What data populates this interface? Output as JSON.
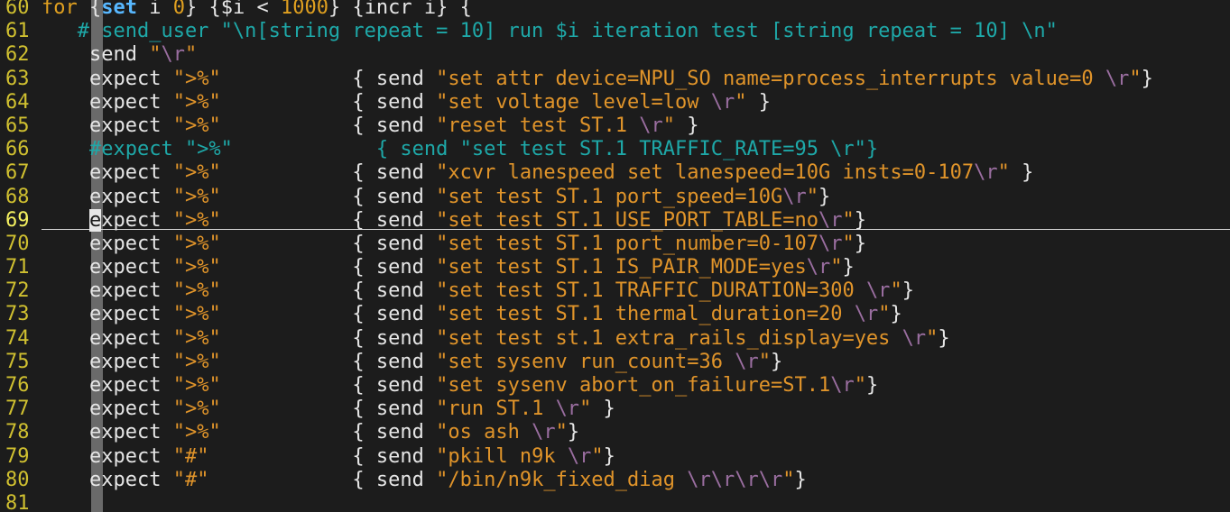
{
  "editor": {
    "colors": {
      "background": "#1c1c1c",
      "line_number": "#d0c030",
      "keyword": "#e0a020",
      "string": "#e0942a",
      "escape": "#9a6ea0",
      "comment": "#1ea8a8",
      "plain": "#e6e6e6"
    },
    "current_line": 69,
    "lines": [
      {
        "num": "60",
        "tokens": [
          {
            "t": "kw",
            "v": "for"
          },
          {
            "t": "plain",
            "v": " {"
          },
          {
            "t": "kwb",
            "v": "set"
          },
          {
            "t": "plain",
            "v": " i "
          },
          {
            "t": "num",
            "v": "0"
          },
          {
            "t": "plain",
            "v": "} {$i < "
          },
          {
            "t": "num",
            "v": "1000"
          },
          {
            "t": "plain",
            "v": "} {incr i} {"
          }
        ]
      },
      {
        "num": "61",
        "tokens": [
          {
            "t": "cmt",
            "v": "   # send_user \"\\n[string repeat = 10] run $i iteration test [string repeat = 10] \\n\""
          }
        ]
      },
      {
        "num": "62",
        "tokens": [
          {
            "t": "plain",
            "v": "    send "
          },
          {
            "t": "str",
            "v": "\""
          },
          {
            "t": "esc",
            "v": "\\r"
          },
          {
            "t": "str",
            "v": "\""
          }
        ]
      },
      {
        "num": "63",
        "tokens": [
          {
            "t": "plain",
            "v": "    expect "
          },
          {
            "t": "str",
            "v": "\">%\""
          },
          {
            "t": "plain",
            "v": "           { send "
          },
          {
            "t": "str",
            "v": "\"set attr device=NPU_SO name=process_interrupts value=0 "
          },
          {
            "t": "esc",
            "v": "\\r"
          },
          {
            "t": "str",
            "v": "\""
          },
          {
            "t": "plain",
            "v": "}"
          }
        ]
      },
      {
        "num": "64",
        "tokens": [
          {
            "t": "plain",
            "v": "    expect "
          },
          {
            "t": "str",
            "v": "\">%\""
          },
          {
            "t": "plain",
            "v": "           { send "
          },
          {
            "t": "str",
            "v": "\"set voltage level=low "
          },
          {
            "t": "esc",
            "v": "\\r"
          },
          {
            "t": "str",
            "v": "\""
          },
          {
            "t": "plain",
            "v": " }"
          }
        ]
      },
      {
        "num": "65",
        "tokens": [
          {
            "t": "plain",
            "v": "    expect "
          },
          {
            "t": "str",
            "v": "\">%\""
          },
          {
            "t": "plain",
            "v": "           { send "
          },
          {
            "t": "str",
            "v": "\"reset test ST.1 "
          },
          {
            "t": "esc",
            "v": "\\r"
          },
          {
            "t": "str",
            "v": "\""
          },
          {
            "t": "plain",
            "v": " }"
          }
        ]
      },
      {
        "num": "66",
        "tokens": [
          {
            "t": "cmt",
            "v": "    #expect \">%\"            { send \"set test ST.1 TRAFFIC_RATE=95 \\r\"}"
          }
        ]
      },
      {
        "num": "67",
        "tokens": [
          {
            "t": "plain",
            "v": "    expect "
          },
          {
            "t": "str",
            "v": "\">%\""
          },
          {
            "t": "plain",
            "v": "           { send "
          },
          {
            "t": "str",
            "v": "\"xcvr lanespeed set lanespeed=10G insts=0-107"
          },
          {
            "t": "esc",
            "v": "\\r"
          },
          {
            "t": "str",
            "v": "\""
          },
          {
            "t": "plain",
            "v": " }"
          }
        ]
      },
      {
        "num": "68",
        "tokens": [
          {
            "t": "plain",
            "v": "    expect "
          },
          {
            "t": "str",
            "v": "\">%\""
          },
          {
            "t": "plain",
            "v": "           { send "
          },
          {
            "t": "str",
            "v": "\"set test ST.1 port_speed=10G"
          },
          {
            "t": "esc",
            "v": "\\r"
          },
          {
            "t": "str",
            "v": "\""
          },
          {
            "t": "plain",
            "v": "}"
          }
        ]
      },
      {
        "num": "69",
        "tokens": [
          {
            "t": "plain",
            "v": "    "
          },
          {
            "t": "cursor",
            "v": "e"
          },
          {
            "t": "plain",
            "v": "xpect "
          },
          {
            "t": "str",
            "v": "\">%\""
          },
          {
            "t": "plain",
            "v": "           { send "
          },
          {
            "t": "str",
            "v": "\"set test ST.1 USE_PORT_TABLE=no"
          },
          {
            "t": "esc",
            "v": "\\r"
          },
          {
            "t": "str",
            "v": "\""
          },
          {
            "t": "plain",
            "v": "}"
          }
        ]
      },
      {
        "num": "70",
        "tokens": [
          {
            "t": "plain",
            "v": "    expect "
          },
          {
            "t": "str",
            "v": "\">%\""
          },
          {
            "t": "plain",
            "v": "           { send "
          },
          {
            "t": "str",
            "v": "\"set test ST.1 port_number=0-107"
          },
          {
            "t": "esc",
            "v": "\\r"
          },
          {
            "t": "str",
            "v": "\""
          },
          {
            "t": "plain",
            "v": "}"
          }
        ]
      },
      {
        "num": "71",
        "tokens": [
          {
            "t": "plain",
            "v": "    expect "
          },
          {
            "t": "str",
            "v": "\">%\""
          },
          {
            "t": "plain",
            "v": "           { send "
          },
          {
            "t": "str",
            "v": "\"set test ST.1 IS_PAIR_MODE=yes"
          },
          {
            "t": "esc",
            "v": "\\r"
          },
          {
            "t": "str",
            "v": "\""
          },
          {
            "t": "plain",
            "v": "}"
          }
        ]
      },
      {
        "num": "72",
        "tokens": [
          {
            "t": "plain",
            "v": "    expect "
          },
          {
            "t": "str",
            "v": "\">%\""
          },
          {
            "t": "plain",
            "v": "           { send "
          },
          {
            "t": "str",
            "v": "\"set test ST.1 TRAFFIC_DURATION=300 "
          },
          {
            "t": "esc",
            "v": "\\r"
          },
          {
            "t": "str",
            "v": "\""
          },
          {
            "t": "plain",
            "v": "}"
          }
        ]
      },
      {
        "num": "73",
        "tokens": [
          {
            "t": "plain",
            "v": "    expect "
          },
          {
            "t": "str",
            "v": "\">%\""
          },
          {
            "t": "plain",
            "v": "           { send "
          },
          {
            "t": "str",
            "v": "\"set test ST.1 thermal_duration=20 "
          },
          {
            "t": "esc",
            "v": "\\r"
          },
          {
            "t": "str",
            "v": "\""
          },
          {
            "t": "plain",
            "v": "}"
          }
        ]
      },
      {
        "num": "74",
        "tokens": [
          {
            "t": "plain",
            "v": "    expect "
          },
          {
            "t": "str",
            "v": "\">%\""
          },
          {
            "t": "plain",
            "v": "           { send "
          },
          {
            "t": "str",
            "v": "\"set test st.1 extra_rails_display=yes "
          },
          {
            "t": "esc",
            "v": "\\r"
          },
          {
            "t": "str",
            "v": "\""
          },
          {
            "t": "plain",
            "v": "}"
          }
        ]
      },
      {
        "num": "75",
        "tokens": [
          {
            "t": "plain",
            "v": "    expect "
          },
          {
            "t": "str",
            "v": "\">%\""
          },
          {
            "t": "plain",
            "v": "           { send "
          },
          {
            "t": "str",
            "v": "\"set sysenv run_count=36 "
          },
          {
            "t": "esc",
            "v": "\\r"
          },
          {
            "t": "str",
            "v": "\""
          },
          {
            "t": "plain",
            "v": "}"
          }
        ]
      },
      {
        "num": "76",
        "tokens": [
          {
            "t": "plain",
            "v": "    expect "
          },
          {
            "t": "str",
            "v": "\">%\""
          },
          {
            "t": "plain",
            "v": "           { send "
          },
          {
            "t": "str",
            "v": "\"set sysenv abort_on_failure=ST.1"
          },
          {
            "t": "esc",
            "v": "\\r"
          },
          {
            "t": "str",
            "v": "\""
          },
          {
            "t": "plain",
            "v": "}"
          }
        ]
      },
      {
        "num": "77",
        "tokens": [
          {
            "t": "plain",
            "v": "    expect "
          },
          {
            "t": "str",
            "v": "\">%\""
          },
          {
            "t": "plain",
            "v": "           { send "
          },
          {
            "t": "str",
            "v": "\"run ST.1 "
          },
          {
            "t": "esc",
            "v": "\\r"
          },
          {
            "t": "str",
            "v": "\""
          },
          {
            "t": "plain",
            "v": " }"
          }
        ]
      },
      {
        "num": "78",
        "tokens": [
          {
            "t": "plain",
            "v": "    expect "
          },
          {
            "t": "str",
            "v": "\">%\""
          },
          {
            "t": "plain",
            "v": "           { send "
          },
          {
            "t": "str",
            "v": "\"os ash "
          },
          {
            "t": "esc",
            "v": "\\r"
          },
          {
            "t": "str",
            "v": "\""
          },
          {
            "t": "plain",
            "v": "}"
          }
        ]
      },
      {
        "num": "79",
        "tokens": [
          {
            "t": "plain",
            "v": "    expect "
          },
          {
            "t": "str",
            "v": "\"#\""
          },
          {
            "t": "plain",
            "v": "            { send "
          },
          {
            "t": "str",
            "v": "\"pkill n9k "
          },
          {
            "t": "esc",
            "v": "\\r"
          },
          {
            "t": "str",
            "v": "\""
          },
          {
            "t": "plain",
            "v": "}"
          }
        ]
      },
      {
        "num": "80",
        "tokens": [
          {
            "t": "plain",
            "v": "    expect "
          },
          {
            "t": "str",
            "v": "\"#\""
          },
          {
            "t": "plain",
            "v": "            { send "
          },
          {
            "t": "str",
            "v": "\"/bin/n9k_fixed_diag "
          },
          {
            "t": "esc",
            "v": "\\r\\r\\r\\r"
          },
          {
            "t": "str",
            "v": "\""
          },
          {
            "t": "plain",
            "v": "}"
          }
        ]
      },
      {
        "num": "81",
        "tokens": []
      }
    ]
  }
}
